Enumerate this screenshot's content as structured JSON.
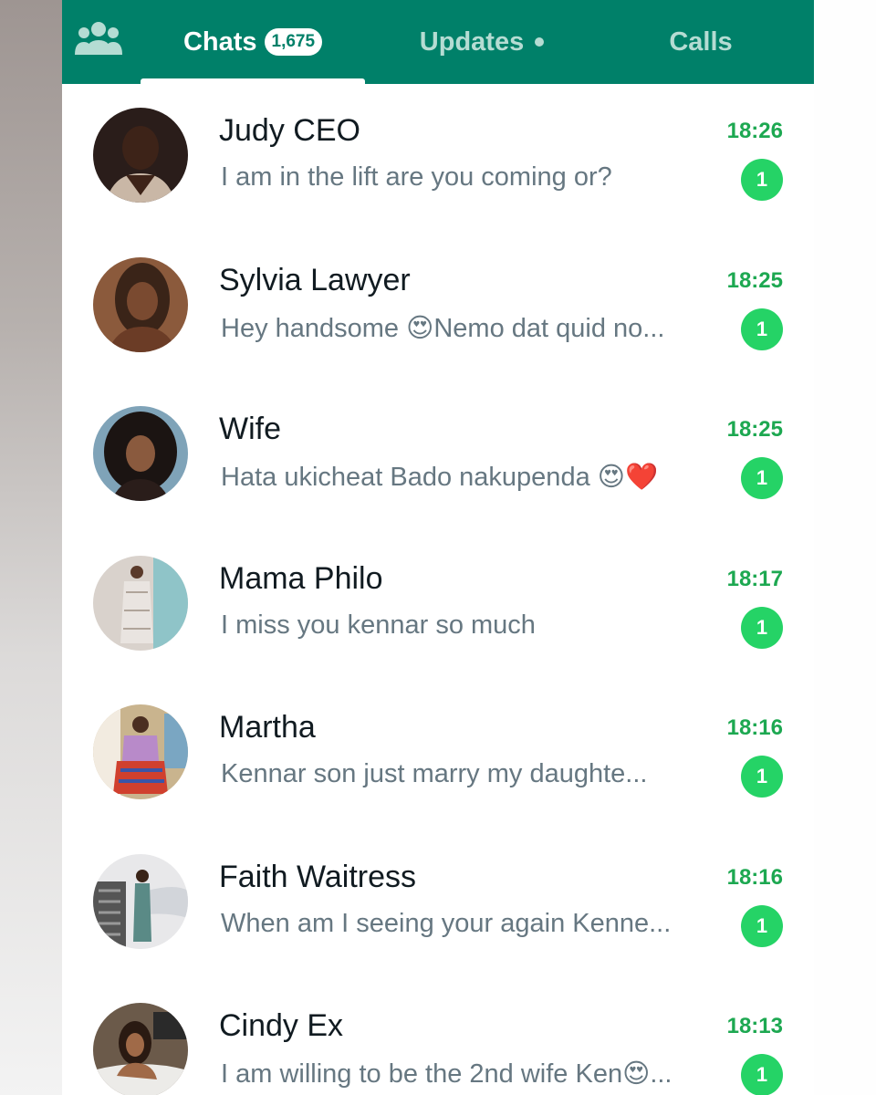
{
  "tabs": {
    "chats_label": "Chats",
    "chats_count": "1,675",
    "updates_label": "Updates",
    "calls_label": "Calls"
  },
  "icons": {
    "community": "community-icon",
    "updates_dot": "dot-indicator-icon"
  },
  "colors": {
    "header": "#008069",
    "accent_green": "#25d366",
    "time_green": "#1da851"
  },
  "chats": [
    {
      "name": "Judy CEO",
      "message": "I am in the lift are you coming or?",
      "time": "18:26",
      "unread": "1"
    },
    {
      "name": "Sylvia Lawyer",
      "message": "Hey handsome 😍Nemo dat quid no...",
      "time": "18:25",
      "unread": "1"
    },
    {
      "name": "Wife",
      "message": "Hata ukicheat Bado nakupenda 😍❤️",
      "time": "18:25",
      "unread": "1"
    },
    {
      "name": "Mama Philo",
      "message": "I miss you kennar so much",
      "time": "18:17",
      "unread": "1"
    },
    {
      "name": "Martha",
      "message": "Kennar son just marry my daughte...",
      "time": "18:16",
      "unread": "1"
    },
    {
      "name": "Faith Waitress",
      "message": "When am I seeing your again Kenne...",
      "time": "18:16",
      "unread": "1"
    },
    {
      "name": "Cindy Ex",
      "message": "I am willing to be the 2nd wife Ken😍...",
      "time": "18:13",
      "unread": "1"
    }
  ]
}
